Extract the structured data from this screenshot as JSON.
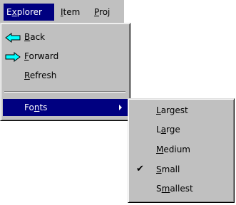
{
  "menubar": {
    "explorer": {
      "pre": "E",
      "u": "x",
      "post": "plorer"
    },
    "item": {
      "pre": "",
      "u": "I",
      "post": "tem"
    },
    "project": {
      "pre": "",
      "u": "P",
      "post": "roj"
    }
  },
  "explorer_menu": {
    "back": {
      "pre": "",
      "u": "B",
      "post": "ack",
      "icon": "back-arrow-icon"
    },
    "forward": {
      "pre": "",
      "u": "F",
      "post": "orward",
      "icon": "forward-arrow-icon"
    },
    "refresh": {
      "pre": "",
      "u": "R",
      "post": "efresh"
    },
    "fonts": {
      "pre": "Fo",
      "u": "n",
      "post": "ts",
      "submenu_icon": "submenu-arrow-icon"
    }
  },
  "fonts_menu": {
    "largest": {
      "pre": "",
      "u": "L",
      "post": "argest"
    },
    "large": {
      "pre": "L",
      "u": "a",
      "post": "rge"
    },
    "medium": {
      "pre": "",
      "u": "M",
      "post": "edium"
    },
    "small": {
      "pre": "",
      "u": "S",
      "post": "mall",
      "checked": true,
      "check": "✔"
    },
    "smallest": {
      "pre": "S",
      "u": "m",
      "post": "allest"
    }
  },
  "colors": {
    "menu_bg": "#c0c0c0",
    "highlight": "#000080",
    "arrow_fill": "#00ffff"
  }
}
